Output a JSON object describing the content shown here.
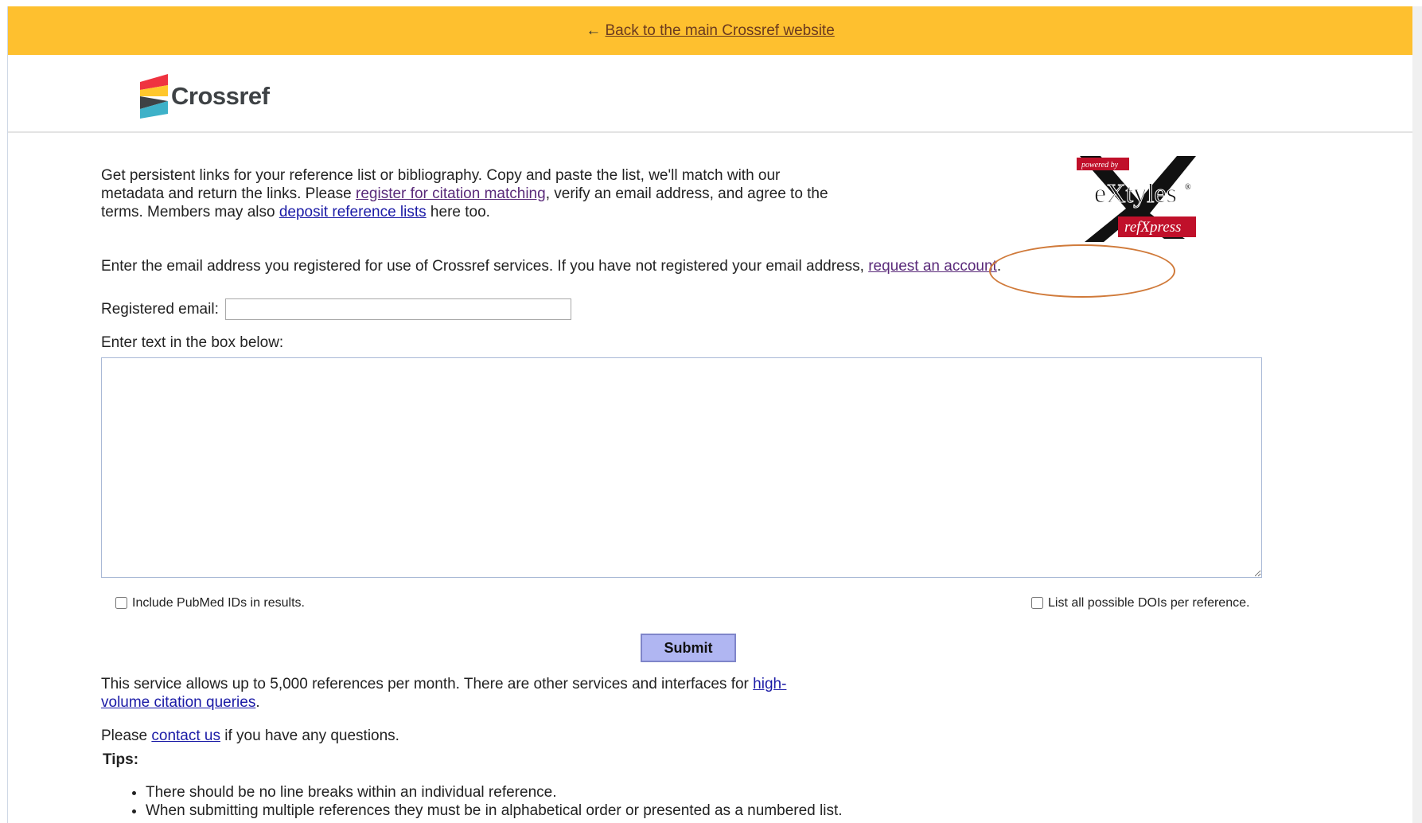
{
  "banner": {
    "arrow": "←",
    "link_text": "Back to the main Crossref website"
  },
  "logo": {
    "text": "Crossref",
    "colors": [
      "#ef3340",
      "#ffc72c",
      "#3eb1c8",
      "#3e4245"
    ]
  },
  "extyles_logo": {
    "top_tag": "powered by",
    "main": "eXtyles",
    "registered": "®",
    "sub": "refXpress"
  },
  "intro": {
    "part1": "Get persistent links for your reference list or bibliography. Copy and paste the list, we'll match with our metadata and return the links. Please ",
    "link1": "register for citation matching",
    "part2": ", verify an email address, and agree to the terms. Members may also ",
    "link2": "deposit reference lists",
    "part3": " here too."
  },
  "email_prompt": {
    "text": "Enter the email address you registered for use of Crossref services. If you have not registered your email address, ",
    "link": "request an account",
    "end": "."
  },
  "form": {
    "email_label": "Registered email:",
    "email_value": "",
    "box_label": "Enter text in the box below:",
    "box_value": "",
    "pubmed_label": "Include PubMed IDs in results.",
    "pubmed_checked": false,
    "all_dois_label": "List all possible DOIs per reference.",
    "all_dois_checked": false,
    "submit_label": "Submit"
  },
  "footer": {
    "allow_text": "This service allows up to 5,000 references per month. There are other services and interfaces for ",
    "allow_link": "high-volume citation queries",
    "allow_end": ".",
    "contact_pre": "Please ",
    "contact_link": "contact us",
    "contact_post": " if you have any questions.",
    "tips_heading": "Tips:",
    "tips": [
      "There should be no line breaks within an individual reference.",
      "When submitting multiple references they must be in alphabetical order or presented as a numbered list."
    ]
  },
  "annotation_color": "#d07a3a",
  "banner_color": "#fec02f"
}
